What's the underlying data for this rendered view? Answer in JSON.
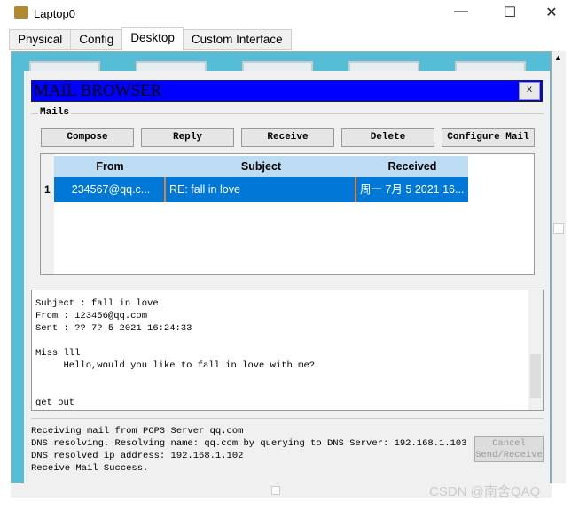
{
  "window": {
    "title": "Laptop0",
    "minimize": "—",
    "maximize": "☐",
    "close": "✕"
  },
  "tabs": [
    {
      "label": "Physical"
    },
    {
      "label": "Config"
    },
    {
      "label": "Desktop",
      "active": true
    },
    {
      "label": "Custom Interface"
    }
  ],
  "mail_browser": {
    "title": "MAIL BROWSER",
    "close_label": "X",
    "group_label": "Mails",
    "buttons": {
      "compose": "Compose",
      "reply": "Reply",
      "receive": "Receive",
      "delete": "Delete",
      "configure": "Configure Mail"
    },
    "table": {
      "headers": {
        "from": "From",
        "subject": "Subject",
        "received": "Received"
      },
      "rows": [
        {
          "num": "1",
          "from": "234567@qq.c...",
          "subject": "RE: fall in love",
          "received": "周一 7月 5 2021 16..."
        }
      ]
    },
    "message": {
      "subject_line": "Subject : fall in love",
      "from_line": "From : 123456@qq.com",
      "sent_line": "Sent : ?? 7? 5 2021 16:24:33",
      "greeting": "Miss lll",
      "body": "     Hello,would you like to fall in love with me?",
      "reply": "get out"
    },
    "log": [
      "Receiving mail from POP3 Server qq.com",
      "DNS resolving. Resolving name: qq.com by querying to DNS Server: 192.168.1.103",
      "DNS resolved ip address: 192.168.1.102",
      "Receive Mail Success."
    ],
    "cancel_label": "Cancel\nSend/Receive"
  },
  "watermark": "CSDN @南舍QAQ",
  "colors": {
    "header_blue": "#0000ff",
    "desktop": "#55bed6",
    "selected_row": "#0078d7",
    "table_header": "#bcdcf3"
  }
}
